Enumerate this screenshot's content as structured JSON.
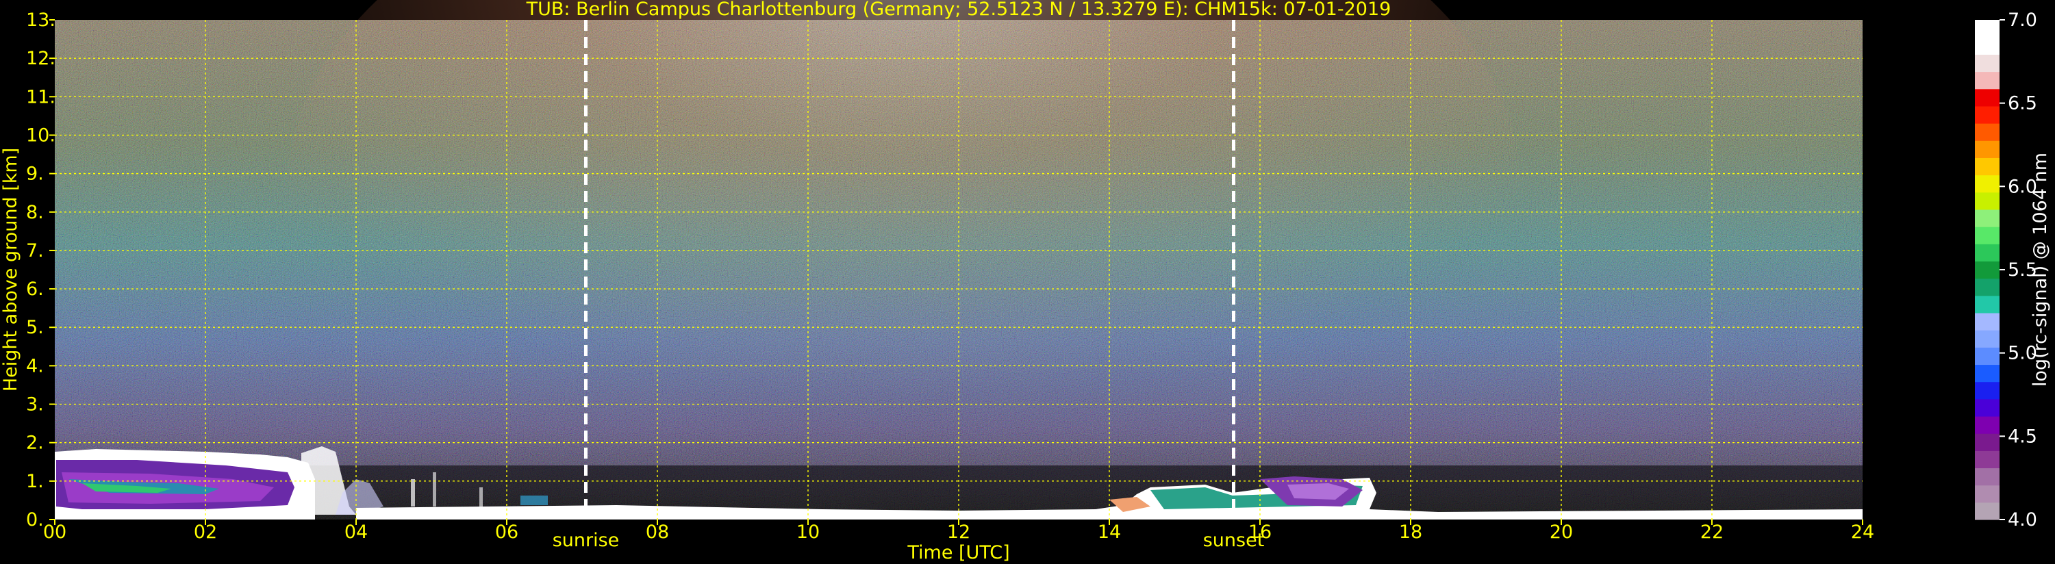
{
  "chart_data": {
    "type": "heatmap",
    "title": "TUB: Berlin Campus Charlottenburg (Germany; 52.5123 N / 13.3279 E):    CHM15k: 07-01-2019",
    "xlabel": "Time [UTC]",
    "ylabel": "Height above ground [km]",
    "xlim": [
      0,
      24
    ],
    "ylim": [
      0,
      13
    ],
    "x_tick_labels": [
      "00",
      "02",
      "04",
      "06",
      "08",
      "10",
      "12",
      "14",
      "16",
      "18",
      "20",
      "22",
      "24"
    ],
    "y_tick_labels": [
      "0.",
      "1.",
      "2.",
      "3.",
      "4.",
      "5.",
      "6.",
      "7.",
      "8.",
      "9.",
      "10.",
      "11.",
      "12.",
      "13."
    ],
    "grid": true,
    "grid_color": "#ffff00",
    "markers": [
      {
        "label": "sunrise",
        "x": 7.05
      },
      {
        "label": "sunset",
        "x": 15.65
      }
    ],
    "colorbar": {
      "label": "log(rc-signal) @ 1064 nm",
      "range": [
        4.0,
        7.0
      ],
      "tick_labels": [
        "4.0",
        "4.5",
        "5.0",
        "5.5",
        "6.0",
        "6.5",
        "7.0"
      ],
      "colors": [
        "#b4a4b4",
        "#b08cb0",
        "#a270a6",
        "#8e3a96",
        "#7a1a8e",
        "#7e00b0",
        "#4a00d8",
        "#1a20f0",
        "#1a5cff",
        "#5c8cff",
        "#86a8ff",
        "#a4b8ff",
        "#22c8a8",
        "#14a26a",
        "#129a3a",
        "#2cc85a",
        "#58e868",
        "#8ef07a",
        "#c8f000",
        "#f0f000",
        "#ffc800",
        "#ff9600",
        "#ff5a00",
        "#ff1e00",
        "#ee0000",
        "#f4b8b8",
        "#f0dede",
        "#ffffff",
        "#ffffff"
      ]
    },
    "field_colors": [
      "#281a3a",
      "#3e2c6e",
      "#3a54a4",
      "#2c8c86",
      "#508c46",
      "#8a8230",
      "#a07040",
      "#b08868",
      "#d0c6c2"
    ]
  }
}
